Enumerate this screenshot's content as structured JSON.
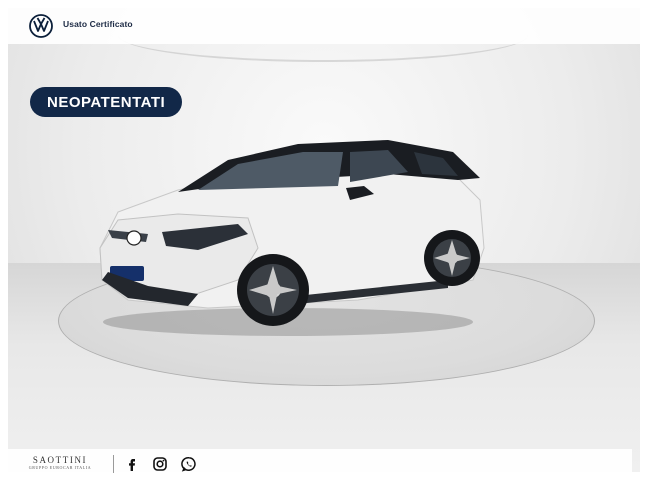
{
  "header": {
    "brand_label": "Usato Certificato",
    "logo_icon": "vw-logo-icon"
  },
  "badge": {
    "label": "NEOPATENTATI",
    "color": "#122848"
  },
  "photo": {
    "subject": "car"
  },
  "footer": {
    "dealer_name": "SAOTTINI",
    "dealer_subtitle": "GRUPPO EUROCAR ITALIA",
    "social_icons": [
      "facebook-icon",
      "instagram-icon",
      "whatsapp-icon"
    ]
  }
}
